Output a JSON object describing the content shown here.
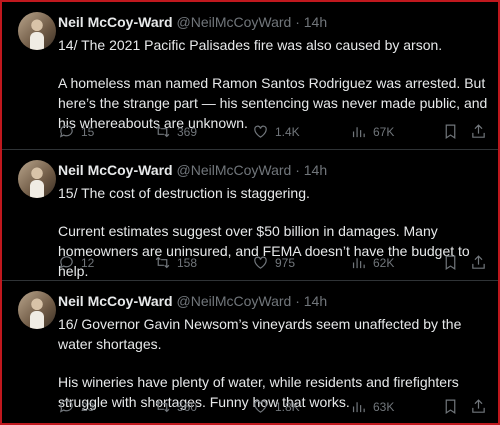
{
  "tweets": [
    {
      "name": "Neil McCoy-Ward",
      "handle": "@NeilMcCoyWard",
      "time": "· 14h",
      "line1": "14/ The 2021 Pacific Palisades fire was also caused by arson.",
      "line2": "A homeless man named Ramon Santos Rodriguez was arrested. But here’s the strange part — his sentencing was never made public, and his whereabouts are unknown.",
      "replies": "15",
      "retweets": "369",
      "likes": "1.4K",
      "views": "67K"
    },
    {
      "name": "Neil McCoy-Ward",
      "handle": "@NeilMcCoyWard",
      "time": "· 14h",
      "line1": "15/ The cost of destruction is staggering.",
      "line2": "Current estimates suggest over $50 billion in damages. Many homeowners are uninsured, and FEMA doesn’t have the budget to help.",
      "replies": "12",
      "retweets": "158",
      "likes": "975",
      "views": "62K"
    },
    {
      "name": "Neil McCoy-Ward",
      "handle": "@NeilMcCoyWard",
      "time": "· 14h",
      "line1": "16/ Governor Gavin Newsom’s vineyards seem unaffected by the water shortages.",
      "line2": "His wineries have plenty of water, while residents and firefighters struggle with shortages. Funny how that works.",
      "replies": "23",
      "retweets": "560",
      "likes": "1.8K",
      "views": "63K"
    }
  ]
}
